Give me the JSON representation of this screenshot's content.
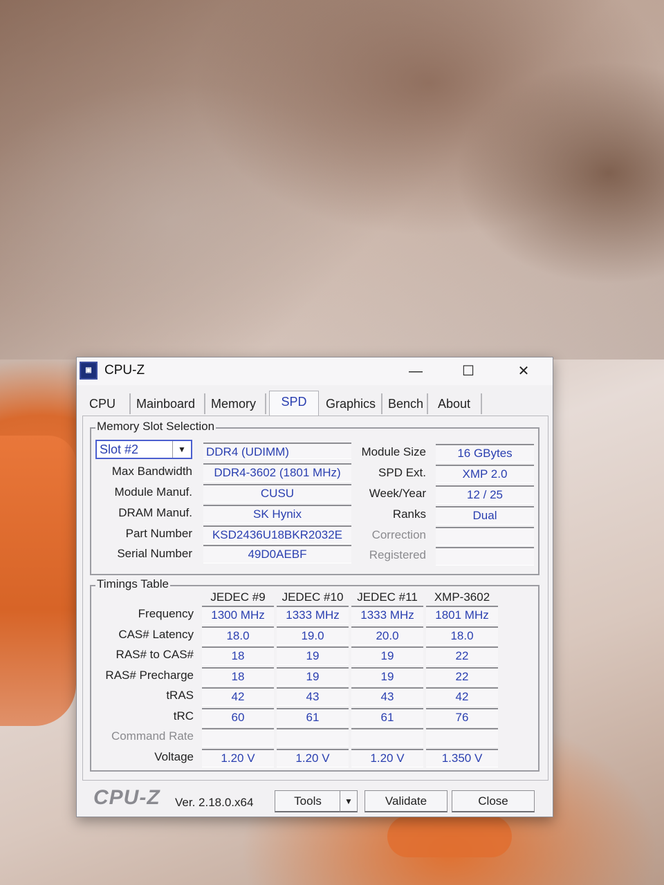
{
  "window": {
    "title": "CPU-Z",
    "minimize": "—",
    "maximize": "☐",
    "close": "✕"
  },
  "tabs": [
    "CPU",
    "Mainboard",
    "Memory",
    "SPD",
    "Graphics",
    "Bench",
    "About"
  ],
  "active_tab": "SPD",
  "slot_group": {
    "title": "Memory Slot Selection",
    "slot_selected": "Slot #2",
    "memory_type": "DDR4 (UDIMM)",
    "rows": [
      {
        "label": "Max Bandwidth",
        "value": "DDR4-3602 (1801 MHz)"
      },
      {
        "label": "Module Manuf.",
        "value": "CUSU"
      },
      {
        "label": "DRAM Manuf.",
        "value": "SK Hynix"
      },
      {
        "label": "Part Number",
        "value": "KSD2436U18BKR2032E"
      },
      {
        "label": "Serial Number",
        "value": "49D0AEBF"
      }
    ],
    "right_rows": [
      {
        "label": "Module Size",
        "value": "16 GBytes"
      },
      {
        "label": "SPD Ext.",
        "value": "XMP 2.0"
      },
      {
        "label": "Week/Year",
        "value": "12 / 25"
      },
      {
        "label": "Ranks",
        "value": "Dual"
      },
      {
        "label": "Correction",
        "value": ""
      },
      {
        "label": "Registered",
        "value": ""
      }
    ]
  },
  "timings": {
    "title": "Timings Table",
    "columns": [
      "JEDEC #9",
      "JEDEC #10",
      "JEDEC #11",
      "XMP-3602"
    ],
    "rows": [
      {
        "label": "Frequency",
        "values": [
          "1300 MHz",
          "1333 MHz",
          "1333 MHz",
          "1801 MHz"
        ]
      },
      {
        "label": "CAS# Latency",
        "values": [
          "18.0",
          "19.0",
          "20.0",
          "18.0"
        ]
      },
      {
        "label": "RAS# to CAS#",
        "values": [
          "18",
          "19",
          "19",
          "22"
        ]
      },
      {
        "label": "RAS# Precharge",
        "values": [
          "18",
          "19",
          "19",
          "22"
        ]
      },
      {
        "label": "tRAS",
        "values": [
          "42",
          "43",
          "43",
          "42"
        ]
      },
      {
        "label": "tRC",
        "values": [
          "60",
          "61",
          "61",
          "76"
        ]
      },
      {
        "label": "Command Rate",
        "values": [
          "",
          "",
          "",
          ""
        ]
      },
      {
        "label": "Voltage",
        "values": [
          "1.20 V",
          "1.20 V",
          "1.20 V",
          "1.350 V"
        ]
      }
    ]
  },
  "footer": {
    "logo": "CPU-Z",
    "version": "Ver. 2.18.0.x64",
    "tools": "Tools",
    "validate": "Validate",
    "close": "Close"
  }
}
